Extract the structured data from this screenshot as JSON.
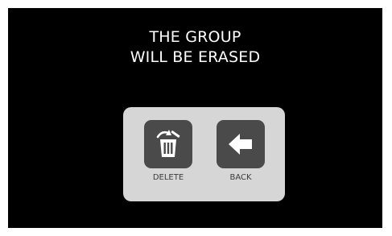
{
  "message": {
    "line1": "THE GROUP",
    "line2": "WILL BE ERASED"
  },
  "actions": {
    "delete": {
      "label": "DELETE",
      "icon": "trash-icon"
    },
    "back": {
      "label": "BACK",
      "icon": "arrow-left-icon"
    }
  },
  "colors": {
    "screen_background": "#000000",
    "message_text": "#ffffff",
    "panel_background": "#d6d6d6",
    "icon_tile": "#4a4a4a",
    "icon_glyph": "#ffffff",
    "label_text": "#3c3c3c"
  }
}
